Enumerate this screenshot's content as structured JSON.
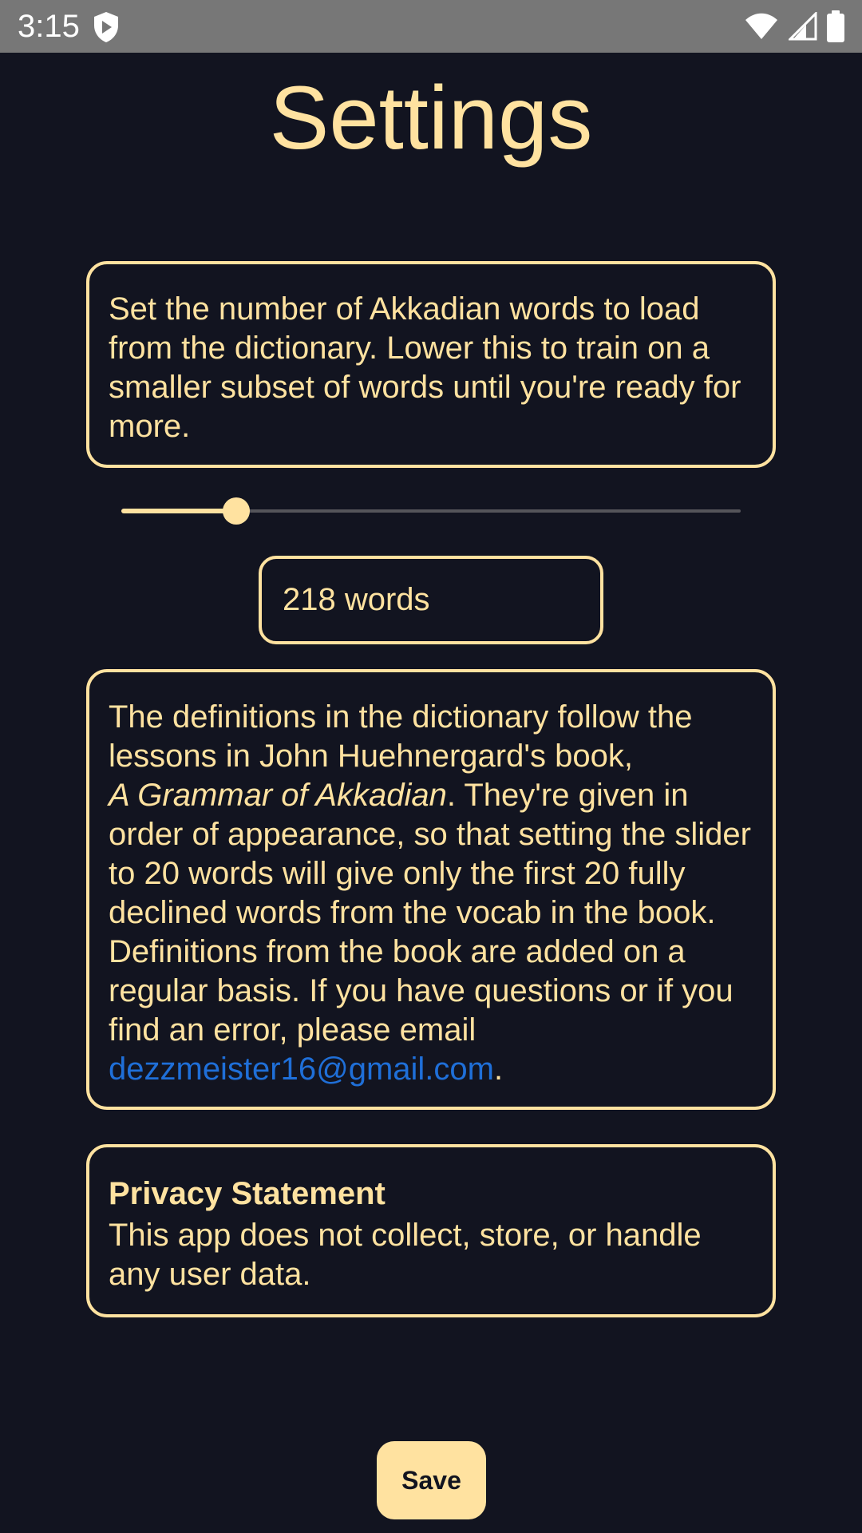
{
  "status_bar": {
    "time": "3:15",
    "icons": [
      "shield-icon",
      "wifi-icon",
      "signal-icon",
      "battery-icon"
    ]
  },
  "settings": {
    "title": "Settings",
    "intro_text": "Set the number of Akkadian words to load from the dictionary. Lower this to train on a smaller subset of words until you're ready for more.",
    "slider_level": 0.186,
    "word_count_value": "218 words",
    "info": {
      "part1": "The definitions in the dictionary follow the lessons in John Huehnergard's book,",
      "book_title": "A Grammar of Akkadian",
      "part2": ". They're given in order of appearance, so that setting the slider to 20 words will give only the first 20 fully declined words from the vocab in the book. Definitions from the book are added on a regular basis. If you have questions or if you find an error, please email",
      "email": "dezzmeister16@gmail.com",
      "end": "."
    },
    "privacy": {
      "title": "Privacy Statement",
      "body": "This app does not collect, store, or handle any user data."
    },
    "save_label": "Save"
  },
  "colors": {
    "background": "#121420",
    "accent": "#ffe2a0",
    "link": "#1f6fd8",
    "status_bar": "#777777"
  }
}
